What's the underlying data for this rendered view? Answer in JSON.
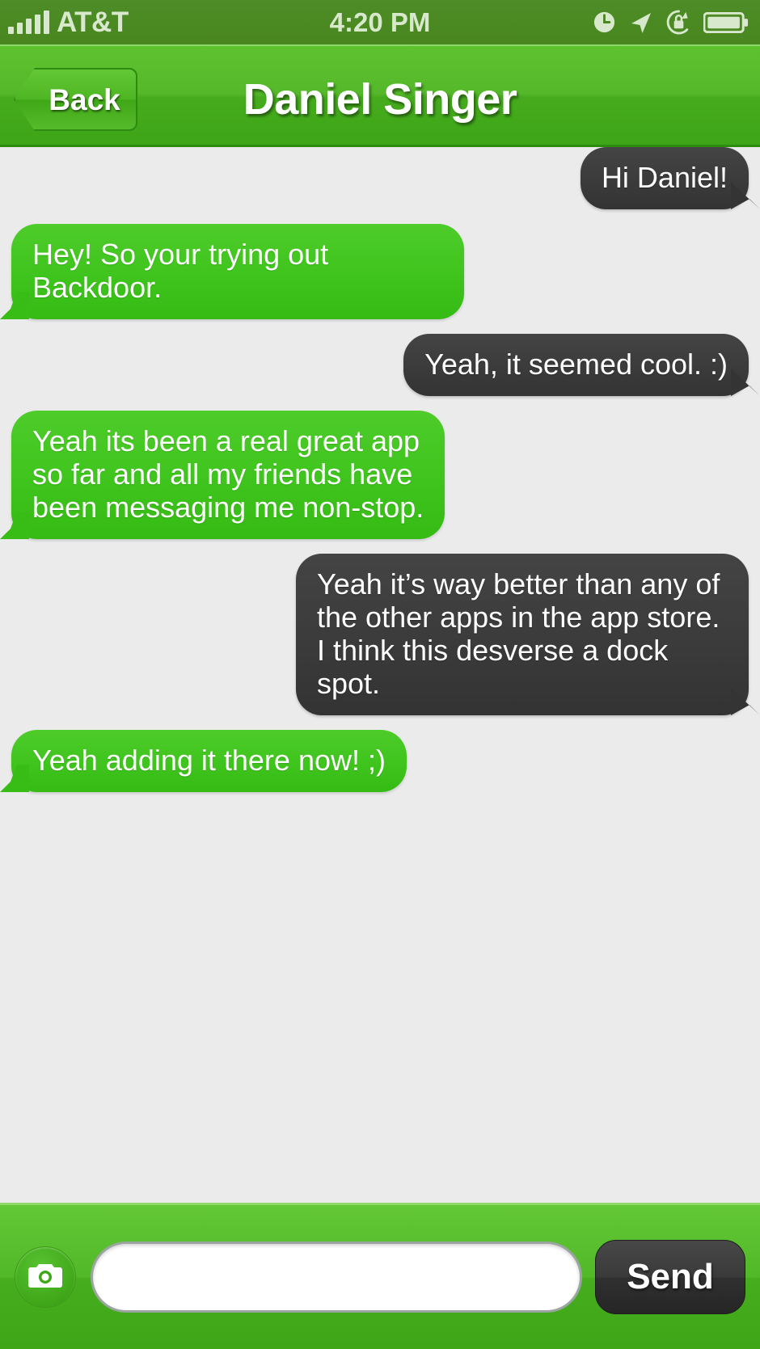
{
  "status_bar": {
    "carrier": "AT&T",
    "time": "4:20 PM",
    "signal_bars_filled": 5,
    "icons": [
      "alarm-clock-icon",
      "location-arrow-icon",
      "rotation-lock-icon",
      "battery-icon"
    ],
    "background_color": "#4a8722",
    "text_color": "#d8e8cc"
  },
  "nav_bar": {
    "back_label": "Back",
    "title": "Daniel Singer",
    "background_color": "#4bb224"
  },
  "chat": {
    "background_color": "#ebebeb",
    "incoming_bubble_color": "#3fc41d",
    "outgoing_bubble_color": "#3b3b3b",
    "messages": [
      {
        "side": "outgoing",
        "text": "Hi Daniel!"
      },
      {
        "side": "incoming",
        "text": "Hey! So your trying out Backdoor."
      },
      {
        "side": "outgoing",
        "text": "Yeah, it seemed cool. :)"
      },
      {
        "side": "incoming",
        "text": "Yeah its been a real great app\nso far and all my friends have\nbeen messaging me non-stop."
      },
      {
        "side": "outgoing",
        "text": "Yeah it’s way better than any of\nthe other apps in the app store.\nI think this desverse a dock spot."
      },
      {
        "side": "incoming",
        "text": "Yeah adding it there now! ;)"
      }
    ]
  },
  "toolbar": {
    "camera_icon": "camera-icon",
    "input_value": "",
    "input_placeholder": "",
    "send_label": "Send",
    "background_color": "#4bb224"
  }
}
